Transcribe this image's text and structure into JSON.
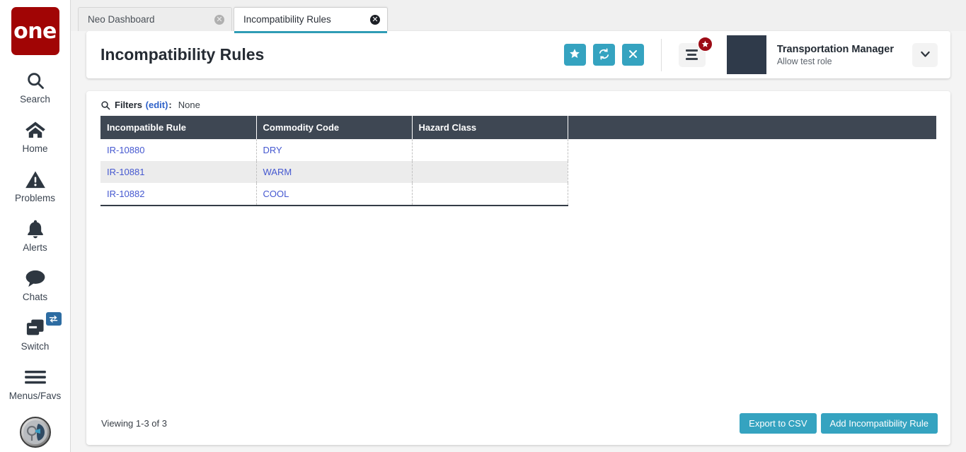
{
  "sidebar": {
    "logo_text": "one",
    "items": [
      {
        "label": "Search",
        "icon": "search-icon"
      },
      {
        "label": "Home",
        "icon": "home-icon"
      },
      {
        "label": "Problems",
        "icon": "warning-triangle-icon"
      },
      {
        "label": "Alerts",
        "icon": "bell-icon"
      },
      {
        "label": "Chats",
        "icon": "chat-bubble-icon"
      },
      {
        "label": "Switch",
        "icon": "windows-stack-icon",
        "badge_icon": "exchange-arrows-icon"
      },
      {
        "label": "Menus/Favs",
        "icon": "hamburger-icon"
      }
    ],
    "avatar_icon": "user-avatar-icon"
  },
  "tabs": [
    {
      "label": "Neo Dashboard",
      "active": false,
      "close_icon": "close-circle-icon"
    },
    {
      "label": "Incompatibility Rules",
      "active": true,
      "close_icon": "close-circle-icon"
    }
  ],
  "header": {
    "title": "Incompatibility Rules",
    "actions": [
      {
        "name": "favorite-button",
        "icon": "star-icon"
      },
      {
        "name": "refresh-button",
        "icon": "refresh-icon"
      },
      {
        "name": "close-button",
        "icon": "x-icon"
      }
    ],
    "menu_button": {
      "icon": "menu-lines-icon",
      "badge_icon": "star-icon"
    },
    "user": {
      "name": "Transportation Manager",
      "role": "Allow test role",
      "chevron_icon": "chevron-down-icon"
    }
  },
  "filters": {
    "icon": "search-icon",
    "label": "Filters",
    "edit_label": "(edit)",
    "colon": ":",
    "value": "None"
  },
  "table": {
    "columns": [
      "Incompatible Rule",
      "Commodity Code",
      "Hazard Class",
      ""
    ],
    "rows": [
      {
        "rule": "IR-10880",
        "commodity": "DRY",
        "hazard": ""
      },
      {
        "rule": "IR-10881",
        "commodity": "WARM",
        "hazard": ""
      },
      {
        "rule": "IR-10882",
        "commodity": "COOL",
        "hazard": ""
      }
    ]
  },
  "footer": {
    "viewing": "Viewing 1-3 of 3",
    "export_label": "Export to CSV",
    "add_label": "Add Incompatibility Rule"
  },
  "colors": {
    "teal": "#35a3c0",
    "header_row": "#3e4753",
    "logo_red": "#a10505",
    "link_blue": "#4558d0",
    "edit_blue": "#2f62c9",
    "badge_red": "#9c0b15",
    "tab_underline": "#2f9cb5",
    "avatar_navy": "#2f3a4a"
  }
}
